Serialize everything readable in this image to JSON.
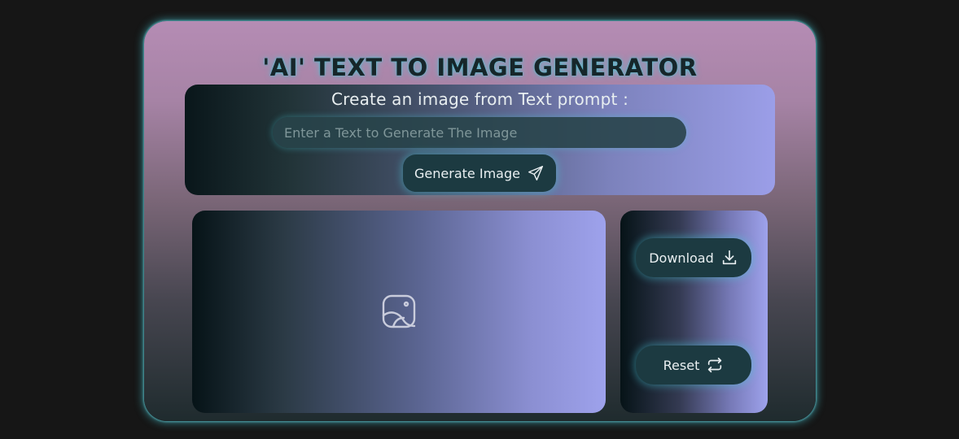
{
  "app": {
    "title": "'AI' TEXT TO IMAGE GENERATOR"
  },
  "prompt": {
    "label": "Create an image from Text prompt :",
    "input_value": "",
    "placeholder": "Enter a Text to Generate The Image",
    "generate_label": "Generate Image",
    "generate_icon": "send-icon"
  },
  "preview": {
    "placeholder_icon": "image-icon"
  },
  "actions": {
    "download_label": "Download",
    "download_icon": "download-icon",
    "reset_label": "Reset",
    "reset_icon": "repeat-icon"
  },
  "colors": {
    "page_background": "#161616",
    "accent_glow": "#48c8d6",
    "button_fill": "#1c3a41",
    "panel_lavender": "#9ea2ec"
  }
}
